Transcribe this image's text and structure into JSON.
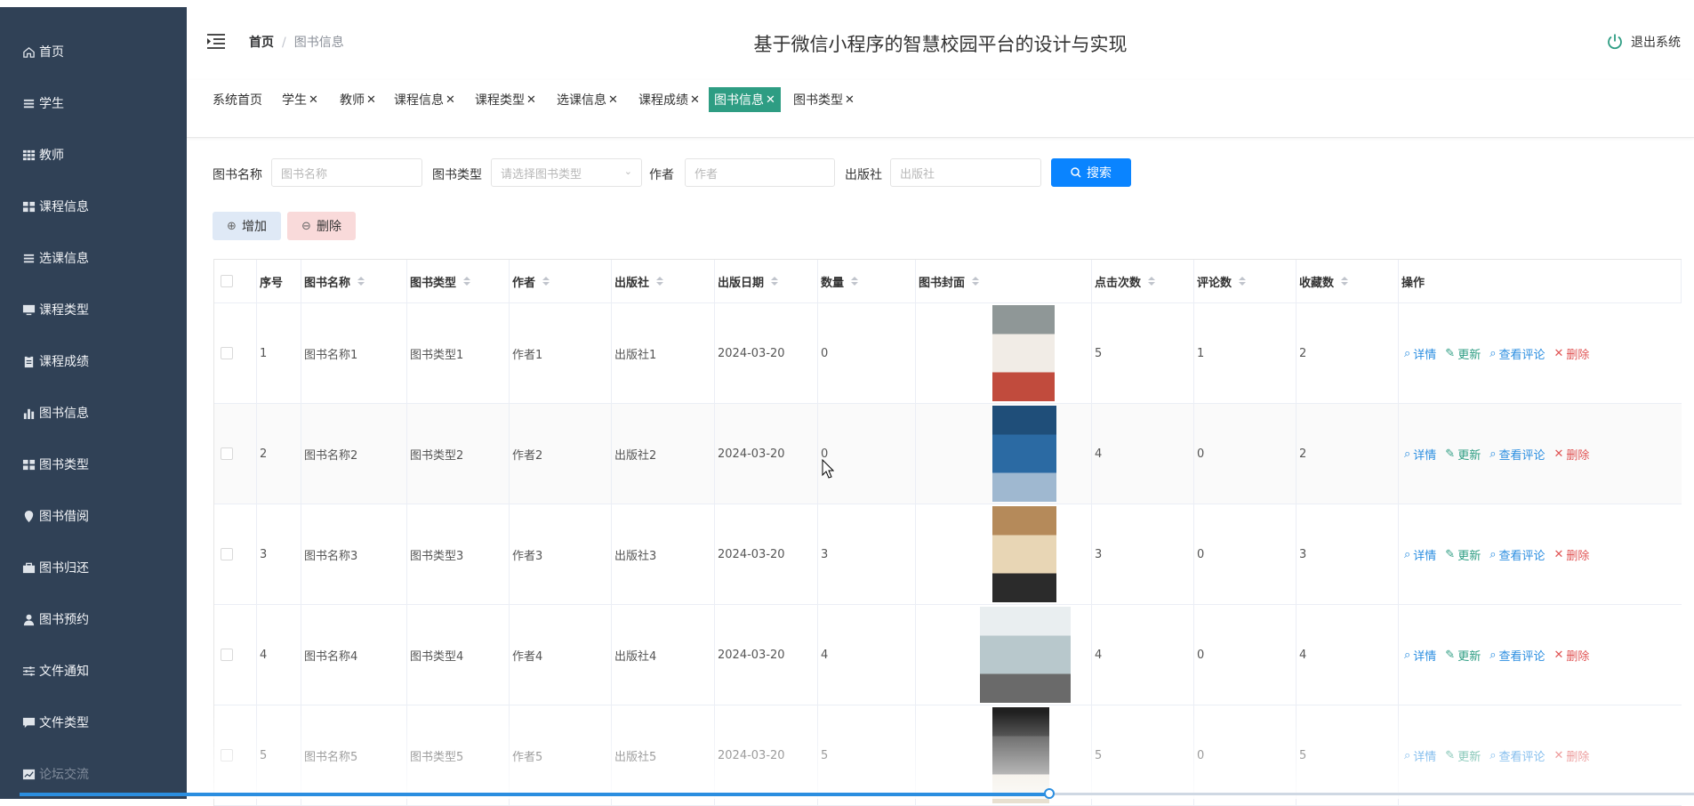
{
  "app_title": "基于微信小程序的智慧校园平台的设计与实现",
  "logout_label": "退出系统",
  "breadcrumb": {
    "home": "首页",
    "current": "图书信息"
  },
  "sidebar": {
    "items": [
      {
        "label": "首页",
        "icon": "home-icon"
      },
      {
        "label": "学生",
        "icon": "list-icon"
      },
      {
        "label": "教师",
        "icon": "grid-icon"
      },
      {
        "label": "课程信息",
        "icon": "dashboard-icon"
      },
      {
        "label": "选课信息",
        "icon": "list-icon"
      },
      {
        "label": "课程类型",
        "icon": "monitor-icon"
      },
      {
        "label": "课程成绩",
        "icon": "clipboard-icon"
      },
      {
        "label": "图书信息",
        "icon": "bar-chart-icon"
      },
      {
        "label": "图书类型",
        "icon": "dashboard-icon"
      },
      {
        "label": "图书借阅",
        "icon": "location-icon"
      },
      {
        "label": "图书归还",
        "icon": "briefcase-icon"
      },
      {
        "label": "图书预约",
        "icon": "user-icon"
      },
      {
        "label": "文件通知",
        "icon": "sliders-icon"
      },
      {
        "label": "文件类型",
        "icon": "comment-icon"
      },
      {
        "label": "论坛交流",
        "icon": "line-chart-icon"
      }
    ]
  },
  "tabs": [
    {
      "label": "系统首页",
      "closable": false
    },
    {
      "label": "学生",
      "closable": true
    },
    {
      "label": "教师",
      "closable": true
    },
    {
      "label": "课程信息",
      "closable": true
    },
    {
      "label": "课程类型",
      "closable": true
    },
    {
      "label": "选课信息",
      "closable": true
    },
    {
      "label": "课程成绩",
      "closable": true
    },
    {
      "label": "图书信息",
      "closable": true,
      "active": true
    },
    {
      "label": "图书类型",
      "closable": true
    }
  ],
  "search": {
    "name_label": "图书名称",
    "name_placeholder": "图书名称",
    "type_label": "图书类型",
    "type_placeholder": "请选择图书类型",
    "author_label": "作者",
    "author_placeholder": "作者",
    "publisher_label": "出版社",
    "publisher_placeholder": "出版社",
    "search_button": "搜索"
  },
  "actions": {
    "add": "增加",
    "delete": "删除"
  },
  "table": {
    "headers": [
      "序号",
      "图书名称",
      "图书类型",
      "作者",
      "出版社",
      "出版日期",
      "数量",
      "图书封面",
      "点击次数",
      "评论数",
      "收藏数",
      "操作"
    ],
    "rows": [
      {
        "no": "1",
        "name": "图书名称1",
        "type": "图书类型1",
        "author": "作者1",
        "publisher": "出版社1",
        "date": "2024-03-20",
        "qty": "0",
        "clicks": "5",
        "comments": "1",
        "favorites": "2"
      },
      {
        "no": "2",
        "name": "图书名称2",
        "type": "图书类型2",
        "author": "作者2",
        "publisher": "出版社2",
        "date": "2024-03-20",
        "qty": "0",
        "clicks": "4",
        "comments": "0",
        "favorites": "2"
      },
      {
        "no": "3",
        "name": "图书名称3",
        "type": "图书类型3",
        "author": "作者3",
        "publisher": "出版社3",
        "date": "2024-03-20",
        "qty": "3",
        "clicks": "3",
        "comments": "0",
        "favorites": "3"
      },
      {
        "no": "4",
        "name": "图书名称4",
        "type": "图书类型4",
        "author": "作者4",
        "publisher": "出版社4",
        "date": "2024-03-20",
        "qty": "4",
        "clicks": "4",
        "comments": "0",
        "favorites": "4"
      },
      {
        "no": "5",
        "name": "图书名称5",
        "type": "图书类型5",
        "author": "作者5",
        "publisher": "出版社5",
        "date": "2024-03-20",
        "qty": "5",
        "clicks": "5",
        "comments": "0",
        "favorites": "5"
      }
    ],
    "row_actions": {
      "detail": "详情",
      "update": "更新",
      "review": "查看评论",
      "delete": "删除"
    }
  },
  "colors": {
    "sidebar_bg": "#304156",
    "accent": "#2e9d83",
    "primary": "#0a84ff",
    "danger": "#e05555"
  }
}
